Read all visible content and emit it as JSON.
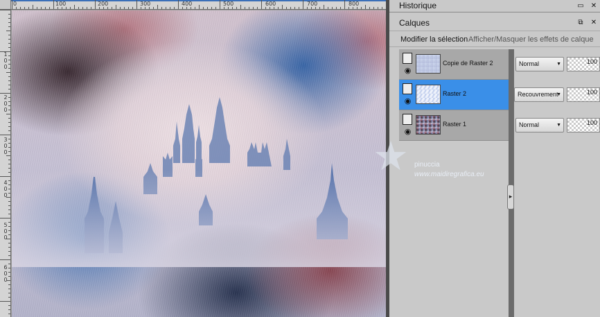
{
  "ruler": {
    "x_labels": [
      "0",
      "100",
      "200",
      "300",
      "400",
      "500",
      "600",
      "700",
      "800"
    ],
    "y_labels": [
      "1 0 0",
      "2 0 0",
      "3 0 0",
      "4 0 0",
      "5 0 0",
      "6 0 0"
    ]
  },
  "panels": {
    "historique": {
      "title": "Historique"
    },
    "calques": {
      "title": "Calques",
      "toolbar": {
        "modify_selection": "Modifier la sélection",
        "toggle_effects": "Afficher/Masquer les effets de calque"
      },
      "layers": [
        {
          "name": "Copie de Raster 2",
          "blend": "Normal",
          "opacity": "100",
          "selected": false
        },
        {
          "name": "Raster 2",
          "blend": "Recouvrement",
          "opacity": "100",
          "selected": true
        },
        {
          "name": "Raster 1",
          "blend": "Normal",
          "opacity": "100",
          "selected": false
        }
      ]
    }
  },
  "watermark": {
    "name": "pinuccia",
    "url": "www.maidiregrafica.eu"
  },
  "colors": {
    "selection": "#3a8fe8",
    "panel_bg": "#c9c9c9",
    "layer_bg": "#a8a8a8"
  },
  "icons": {
    "visibility": "eye-icon",
    "layer": "document-icon",
    "dock": "pin-icon",
    "minimize": "minimize-icon",
    "expand": "chevron-right-icon"
  }
}
